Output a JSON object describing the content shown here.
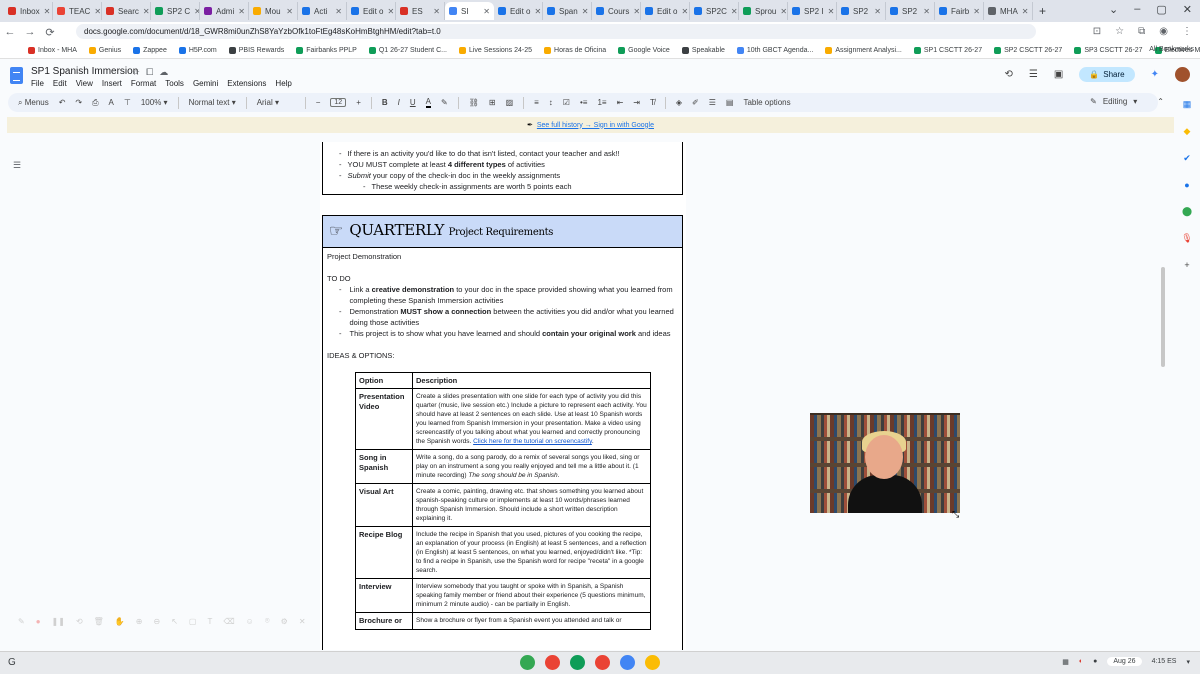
{
  "browser": {
    "tabs": [
      {
        "label": "Inbox",
        "color": "#d93025"
      },
      {
        "label": "TEAC",
        "color": "#ea4335"
      },
      {
        "label": "Searc",
        "color": "#d93025"
      },
      {
        "label": "SP2 C",
        "color": "#0f9d58"
      },
      {
        "label": "Admi",
        "color": "#7b1fa2"
      },
      {
        "label": "Mou",
        "color": "#f9ab00"
      },
      {
        "label": "Acti",
        "color": "#1a73e8"
      },
      {
        "label": "Edit o",
        "color": "#1a73e8"
      },
      {
        "label": "ES",
        "color": "#d93025"
      },
      {
        "label": "SI",
        "color": "#4285f4",
        "active": true
      },
      {
        "label": "Edit o",
        "color": "#1a73e8"
      },
      {
        "label": "Span",
        "color": "#1a73e8"
      },
      {
        "label": "Cours",
        "color": "#1a73e8"
      },
      {
        "label": "Edit o",
        "color": "#1a73e8"
      },
      {
        "label": "SP2C",
        "color": "#1a73e8"
      },
      {
        "label": "Sprou",
        "color": "#0f9d58"
      },
      {
        "label": "SP2 I",
        "color": "#1a73e8"
      },
      {
        "label": "SP2",
        "color": "#1a73e8"
      },
      {
        "label": "SP2",
        "color": "#1a73e8"
      },
      {
        "label": "Fairb",
        "color": "#1a73e8"
      },
      {
        "label": "MHA",
        "color": "#5f6368"
      }
    ],
    "new_tab": "+",
    "window_controls": [
      "⌄",
      "–",
      "▢",
      "✕"
    ],
    "url": "docs.google.com/document/d/18_GWR8mi0unZhS8YaYzbOfk1toFtEg48sKoHmBtghHM/edit?tab=t.0",
    "bookmarks": [
      {
        "label": "Inbox - MHA",
        "color": "#d93025"
      },
      {
        "label": "Genius",
        "color": "#f9ab00"
      },
      {
        "label": "Zappee",
        "color": "#1a73e8"
      },
      {
        "label": "H5P.com",
        "color": "#1a73e8"
      },
      {
        "label": "PBIS Rewards",
        "color": "#3c4043"
      },
      {
        "label": "Fairbanks PPLP",
        "color": "#0f9d58"
      },
      {
        "label": "Q1 26-27 Student C...",
        "color": "#0f9d58"
      },
      {
        "label": "Live Sessions 24-25",
        "color": "#f9ab00"
      },
      {
        "label": "Horas de Oficina",
        "color": "#f9ab00"
      },
      {
        "label": "Google Voice",
        "color": "#0f9d58"
      },
      {
        "label": "Speakable",
        "color": "#3c4043"
      },
      {
        "label": "10th GBCT Agenda...",
        "color": "#4285f4"
      },
      {
        "label": "Assignment Analysi...",
        "color": "#f9ab00"
      },
      {
        "label": "SP1 CSCTT 26-27",
        "color": "#0f9d58"
      },
      {
        "label": "SP2 CSCTT 26-27",
        "color": "#0f9d58"
      },
      {
        "label": "SP3 CSCTT 26-27",
        "color": "#0f9d58"
      },
      {
        "label": "Electives Master 26-...",
        "color": "#0f9d58"
      }
    ],
    "all_bookmarks": "All Bookmarks"
  },
  "doc": {
    "title": "SP1 Spanish Immersion",
    "menu": [
      "File",
      "Edit",
      "View",
      "Insert",
      "Format",
      "Tools",
      "Gemini",
      "Extensions",
      "Help"
    ],
    "share_label": "Share",
    "toolbar": {
      "menus": "Menus",
      "zoom": "100%",
      "style": "Normal text",
      "font": "Arial",
      "font_size": "12",
      "table_options": "Table options",
      "mode": "Editing"
    },
    "history_banner": "See full history → Sign in with Google"
  },
  "content": {
    "top_items": [
      "If there is an activity you'd like to do that isn't listed, contact your teacher and ask!!",
      "YOU MUST complete at least 4 different types of activities",
      "Submit your copy of the check-in doc in the weekly assignments"
    ],
    "top_sub": "These weekly check-in assignments are worth 5 points each",
    "project_title_main": "QUARTERLY",
    "project_title_rest": "Project Requirements",
    "project_demo": "Project Demonstration",
    "todo": "TO DO",
    "todo_items": [
      {
        "pre": "Link a ",
        "bold": "creative demonstration",
        "post": " to your doc in the space provided showing what you learned from completing these Spanish Immersion activities"
      },
      {
        "pre": "Demonstration ",
        "bold": "MUST show a connection",
        "post": " between the activities you did and/or what you learned doing those activities"
      },
      {
        "pre": "This project is to show what you have learned and should ",
        "bold": "contain your original work",
        "post": " and ideas"
      }
    ],
    "ideas": "IDEAS & OPTIONS:",
    "table_headers": [
      "Option",
      "Description"
    ],
    "options": [
      {
        "name": "Presentation Video",
        "desc": "Create a slides presentation with one slide for each type of activity you did this quarter (music, live session etc.) Include a picture to represent each activity. You should have at least 2 sentences on each slide. Use at least 10 Spanish words you learned from Spanish Immersion in your presentation. Make a video using screencastify of you talking about what you learned and correctly pronouncing the Spanish words.",
        "link": "Click here for the tutorial on screencastify",
        "tail": "."
      },
      {
        "name": "Song in Spanish",
        "desc": "Write a song, do a song parody, do a remix of several songs  you liked, sing or play on an instrument a song you really enjoyed and tell me a little about it. (1 minute recording)",
        "italic": "The song should be in Spanish",
        "tail": "."
      },
      {
        "name": "Visual Art",
        "desc": "Create a comic, painting, drawing etc. that shows something you learned about spanish-speaking culture or implements at least 10 words/phrases learned through Spanish Immersion. Should include a short written description explaining it."
      },
      {
        "name": "Recipe Blog",
        "desc": "Include the recipe in Spanish that you used, pictures of you cooking the recipe, an explanation of your process (in English) at least 5 sentences, and a reflection (in English) at least 5 sentences, on what you learned, enjoyed/didn't like. *Tip: to find a recipe in Spanish, use the Spanish word for recipe \"receta\" in a google search."
      },
      {
        "name": "Interview",
        "desc": "Interview somebody that you taught or spoke with in Spanish, a Spanish speaking family member or friend about their experience (5 questions minimum, minimum 2 minute audio) - can be partially in English."
      },
      {
        "name": "Brochure or",
        "desc": "Show a brochure or flyer from a Spanish event you attended and talk or"
      }
    ]
  },
  "taskbar": {
    "date": "Aug 26",
    "time": "4:15 ES",
    "apps": [
      {
        "color": "#34a853"
      },
      {
        "color": "#ea4335"
      },
      {
        "color": "#0f9d58"
      },
      {
        "color": "#ea4335"
      },
      {
        "color": "#4285f4"
      },
      {
        "color": "#fbbc04"
      }
    ]
  }
}
